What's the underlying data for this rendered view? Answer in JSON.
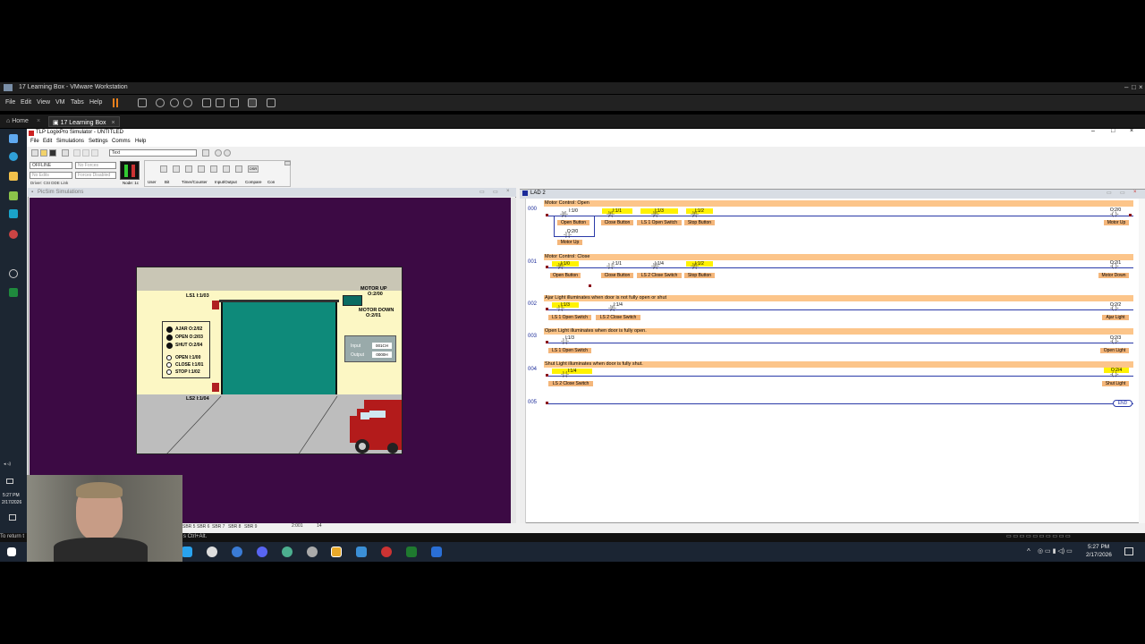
{
  "vmware": {
    "window_title": "17 Learning Box - VMware Workstation",
    "menu": [
      "File",
      "Edit",
      "View",
      "VM",
      "Tabs",
      "Help"
    ],
    "tabs": [
      {
        "label": "Home"
      },
      {
        "label": "17 Learning Box"
      }
    ],
    "bottom_hint": "To return to your computer, press Ctrl+Alt.",
    "bottom_hint_left": "To return t",
    "bottom_hint_right": "s Ctrl+Alt."
  },
  "guest_clock": {
    "time": "5:27 PM",
    "date": "2/17/2026"
  },
  "host_clock": {
    "time": "5:27 PM",
    "date": "2/17/2026"
  },
  "app": {
    "title": "TLP LogixPro Simulator - UNTITLED",
    "menu": [
      "File",
      "Edit",
      "Simulations",
      "Settings",
      "Comms",
      "Help"
    ],
    "search_value": "Text",
    "mode_select": "OFFLINE",
    "forces_select": "No Forces",
    "edits_select": "No Edits",
    "forces_disabled": "Forces Disabled",
    "driver": "Driver: CSI DDE Link",
    "node": "Node: 1c",
    "instr_tabs": [
      "User",
      "Bit",
      "Timer/Counter",
      "Input/Output",
      "Compare",
      "Con"
    ],
    "osr": "OSR"
  },
  "sim": {
    "title": "PicSim Simulations",
    "ls1": "LS1  I:1/03",
    "ls2": "LS2  I:1/04",
    "motor_up": "MOTOR UP\nO:2/00",
    "motor_up_l1": "MOTOR UP",
    "motor_up_l2": "O:2/00",
    "motor_down_l1": "MOTOR DOWN",
    "motor_down_l2": "O:2/01",
    "lights": [
      {
        "label": "AJAR  O:2/02"
      },
      {
        "label": "OPEN  O:2/03"
      },
      {
        "label": "SHUT  O:2/04"
      }
    ],
    "buttons": [
      {
        "label": "OPEN   I:1/00"
      },
      {
        "label": "CLOSE I:1/01"
      },
      {
        "label": "STOP   I:1/02"
      }
    ],
    "io_input_label": "Input",
    "io_input_value": "001CH",
    "io_output_label": "Output",
    "io_output_value": "0000H",
    "status_tabs": [
      "SBR 5",
      "SBR 6",
      "SBR 7",
      "SBR 8",
      "SBR 9"
    ],
    "status_addr": "2:001",
    "status_num": "14"
  },
  "ladder": {
    "title": "LAD 2",
    "rungs": [
      {
        "num": "000",
        "comment": "Motor Control: Open",
        "instructions": [
          {
            "addr": "I:1/0",
            "label": "Open Button"
          },
          {
            "addr": "I:1/1",
            "label": "Close Button"
          },
          {
            "addr": "I:1/3",
            "label": "LS 1 Open Switch"
          },
          {
            "addr": "I:1/2",
            "label": "Stop Button"
          }
        ],
        "branch": {
          "addr": "O:2/0",
          "label": "Motor Up"
        },
        "coil": {
          "addr": "O:2/0",
          "label": "Motor Up"
        }
      },
      {
        "num": "001",
        "comment": "Motor Control: Close",
        "instructions": [
          {
            "addr": "I:1/0",
            "label": "Open Button"
          },
          {
            "addr": "I:1/1",
            "label": "Close Button"
          },
          {
            "addr": "I:1/4",
            "label": "LS 2 Close Switch"
          },
          {
            "addr": "I:1/2",
            "label": "Stop Button"
          }
        ],
        "coil": {
          "addr": "O:2/1",
          "label": "Motor Down"
        }
      },
      {
        "num": "002",
        "comment": "Ajar Light illuminates when door is not fully open or shut",
        "instructions": [
          {
            "addr": "I:1/3",
            "label": "LS 1 Open Switch"
          },
          {
            "addr": "I:1/4",
            "label": "LS 2 Close Switch"
          }
        ],
        "coil": {
          "addr": "O:2/2",
          "label": "Ajar Light"
        }
      },
      {
        "num": "003",
        "comment": "Open Light illuminates when door is fully open.",
        "instructions": [
          {
            "addr": "I:1/3",
            "label": "LS 1 Open Switch"
          }
        ],
        "coil": {
          "addr": "O:2/3",
          "label": "Open Light"
        }
      },
      {
        "num": "004",
        "comment": "Shut Light illuminates when door is fully shut.",
        "instructions": [
          {
            "addr": "I:1/4",
            "label": "LS 2 Close Switch"
          }
        ],
        "coil": {
          "addr": "O:2/4",
          "label": "Shut Light"
        }
      },
      {
        "num": "005",
        "end": "END"
      }
    ]
  }
}
